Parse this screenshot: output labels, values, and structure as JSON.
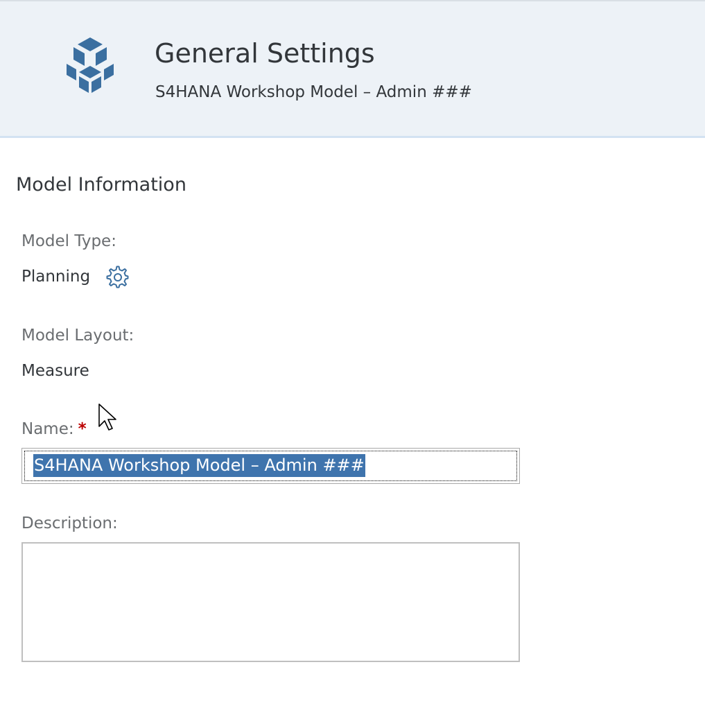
{
  "header": {
    "title": "General Settings",
    "subtitle": "S4HANA Workshop Model – Admin ###",
    "icon": "model-cube-icon",
    "icon_color": "#3b6fa0",
    "background": "#edf2f7"
  },
  "model_information": {
    "section_title": "Model Information",
    "model_type_label": "Model Type:",
    "model_type_value": "Planning",
    "model_type_icon": "gear-icon",
    "model_layout_label": "Model Layout:",
    "model_layout_value": "Measure",
    "name_label": "Name:",
    "name_required_marker": "*",
    "name_value": "S4HANA Workshop Model – Admin ###",
    "description_label": "Description:",
    "description_value": ""
  },
  "colors": {
    "selection": "#3f74ad",
    "required": "#bb0000",
    "label": "#6a6d70",
    "text": "#32363a"
  }
}
